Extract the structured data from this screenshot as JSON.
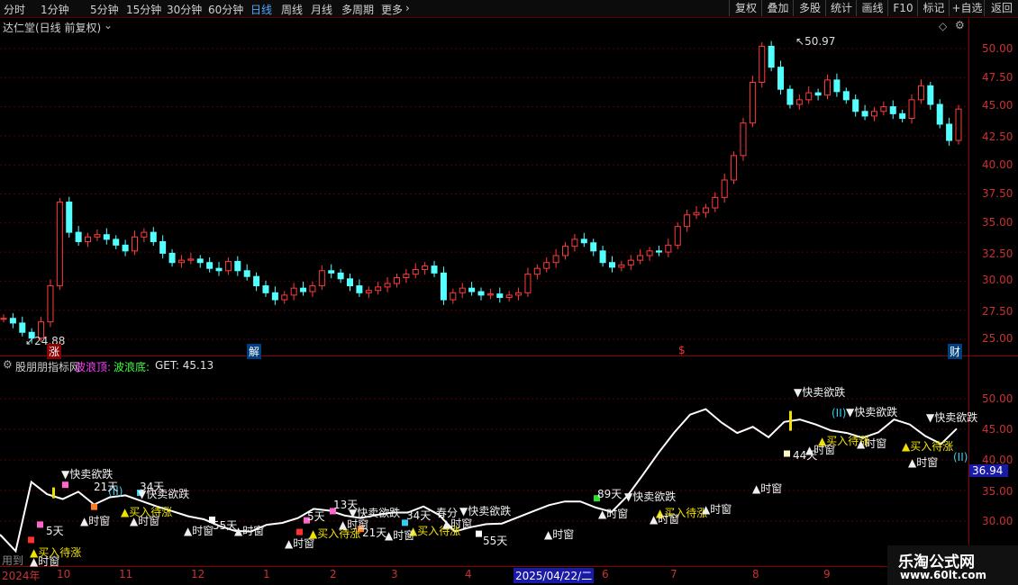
{
  "toolbar": {
    "timeframes": [
      "分时",
      "1分钟",
      "5分钟",
      "15分钟",
      "30分钟",
      "60分钟",
      "日线",
      "周线",
      "月线",
      "多周期",
      "更多"
    ],
    "active": "日线",
    "right_buttons": [
      "复权",
      "叠加",
      "多股",
      "统计",
      "画线",
      "F10",
      "标记",
      "+自选",
      "返回"
    ]
  },
  "main_chart": {
    "title": "达仁堂(日线 前复权)",
    "high_label": "50.97",
    "low_label": "24.88",
    "y_ticks": [
      "50.00",
      "47.50",
      "45.00",
      "42.50",
      "40.00",
      "37.50",
      "35.00",
      "32.50",
      "30.00",
      "27.50",
      "25.00"
    ],
    "event_badges": [
      "涨",
      "解",
      "$",
      "财"
    ]
  },
  "indicator": {
    "name": "股朋朋指标网",
    "label_top": "波浪顶:",
    "label_bottom": "波浪底:",
    "label_get": "GET: 45.13",
    "y_ticks": [
      "50.00",
      "45.00",
      "40.00",
      "35.00",
      "30.00"
    ],
    "current_value": "36.94"
  },
  "x_axis": {
    "labels": [
      "2024年",
      "10",
      "11",
      "12",
      "1",
      "2",
      "3",
      "4",
      "2025/04/22/二",
      "6",
      "7",
      "8",
      "9"
    ],
    "left_hint": "用到"
  },
  "annotations": {
    "sell": "快卖欲跌",
    "buy": "买入待涨",
    "window": "时窗",
    "wave2": "(II)",
    "days": [
      "5天",
      "21天",
      "34天",
      "5天",
      "13天",
      "21天",
      "34天",
      "55天",
      "89天",
      "44天",
      "55天"
    ],
    "misc": "春分"
  },
  "watermark": {
    "line1": "乐淘公式网",
    "line2": "www.60lt.com"
  },
  "chart_data": {
    "type": "candlestick",
    "title": "达仁堂(日线 前复权)",
    "ylim": [
      24,
      53
    ],
    "close_series": [
      26.8,
      26.4,
      25.6,
      25.1,
      26.5,
      29.6,
      36.8,
      34.2,
      33.4,
      33.8,
      34.0,
      33.6,
      33.1,
      32.6,
      33.8,
      34.2,
      33.4,
      32.4,
      31.6,
      31.8,
      31.9,
      31.6,
      31.1,
      30.9,
      31.7,
      30.9,
      30.4,
      29.6,
      29.0,
      28.4,
      28.8,
      29.4,
      29.1,
      29.6,
      30.9,
      30.7,
      30.2,
      29.6,
      29.0,
      29.2,
      29.5,
      29.8,
      30.3,
      30.6,
      31.0,
      31.3,
      30.7,
      28.4,
      29.0,
      29.4,
      29.1,
      28.8,
      28.9,
      28.6,
      28.8,
      29.0,
      30.6,
      31.1,
      31.6,
      32.2,
      33.0,
      33.6,
      33.3,
      32.6,
      31.6,
      31.2,
      31.4,
      31.8,
      32.2,
      32.6,
      32.5,
      33.1,
      34.7,
      35.7,
      35.9,
      36.3,
      37.2,
      38.7,
      40.8,
      43.6,
      47.1,
      50.2,
      48.4,
      46.5,
      45.2,
      45.6,
      46.2,
      46.0,
      47.3,
      46.3,
      45.6,
      44.6,
      44.2,
      44.6,
      45.0,
      44.4,
      44.0,
      45.6,
      46.8,
      45.2,
      43.5,
      42.1,
      44.8
    ],
    "indicator_wave": [
      27.8,
      25.1,
      36.4,
      34.4,
      33.6,
      34.8,
      32.7,
      33.9,
      34.2,
      33.3,
      32.4,
      31.6,
      30.8,
      30.3,
      29.2,
      28.4,
      28.3,
      29.4,
      29.7,
      30.5,
      32.0,
      31.7,
      30.9,
      30.5,
      31.0,
      31.4,
      31.4,
      32.4,
      31.0,
      28.3,
      29.0,
      29.5,
      29.6,
      30.6,
      31.6,
      32.6,
      33.2,
      33.2,
      32.2,
      31.5,
      34.1,
      37.6,
      41.2,
      44.5,
      47.4,
      48.3,
      46.1,
      44.4,
      45.4,
      43.7,
      46.2,
      46.6,
      45.8,
      44.8,
      44.4,
      43.6,
      44.5,
      46.6,
      45.8,
      43.9,
      42.6,
      45.1
    ]
  }
}
